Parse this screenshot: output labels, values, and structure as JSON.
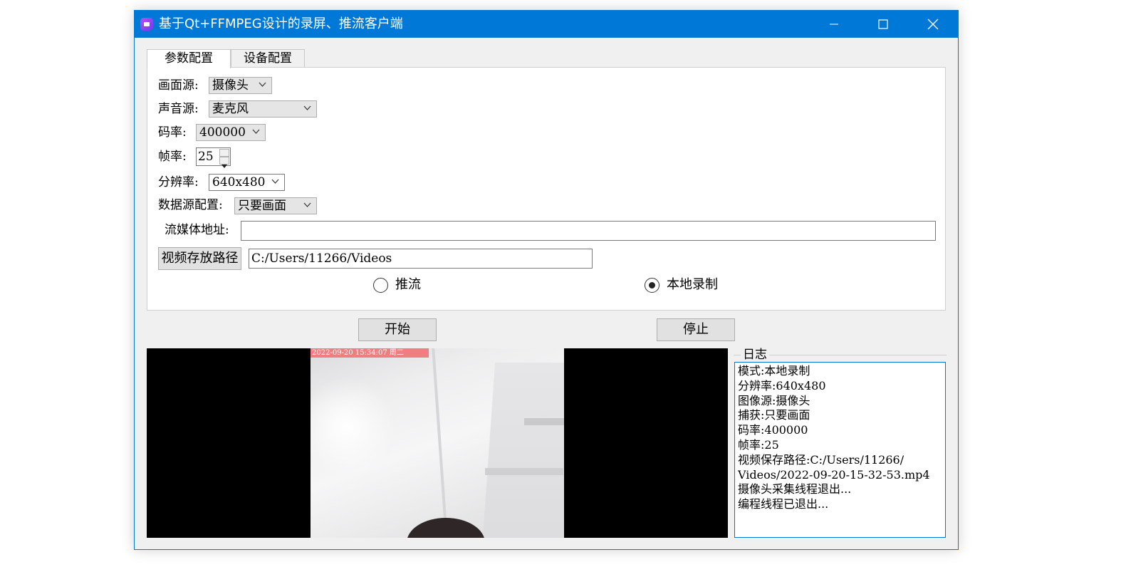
{
  "window": {
    "title": "基于Qt+FFMPEG设计的录屏、推流客户端",
    "accent_color": "#0078d7",
    "controls": [
      "minimize-icon",
      "maximize-icon",
      "close-icon"
    ]
  },
  "tabs": [
    {
      "label": "参数配置",
      "active": true
    },
    {
      "label": "设备配置",
      "active": false
    }
  ],
  "params": {
    "video_source": {
      "label": "画面源:",
      "value": "摄像头"
    },
    "audio_source": {
      "label": "声音源:",
      "value": "麦克风"
    },
    "bitrate": {
      "label": "码率:",
      "value": "400000"
    },
    "framerate": {
      "label": "帧率:",
      "value": "25"
    },
    "resolution": {
      "label": "分辨率:",
      "value": "640x480"
    },
    "data_source": {
      "label": "数据源配置:",
      "value": "只要画面"
    },
    "stream_url": {
      "label": "流媒体地址:",
      "value": ""
    },
    "save_path": {
      "button": "视频存放路径",
      "value": "C:/Users/11266/Videos"
    },
    "mode": {
      "options": [
        {
          "label": "推流",
          "selected": false
        },
        {
          "label": "本地录制",
          "selected": true
        }
      ]
    }
  },
  "actions": {
    "start": "开始",
    "stop": "停止"
  },
  "preview": {
    "timestamp": "2022-09-20 15:34:07 周二"
  },
  "log": {
    "title": "日志",
    "lines": [
      "模式:本地录制",
      "分辨率:640x480",
      "图像源:摄像头",
      "捕获:只要画面",
      "码率:400000",
      "帧率:25",
      "视频保存路径:C:/Users/11266/",
      "Videos/2022-09-20-15-32-53.mp4",
      "摄像头采集线程退出...",
      "编程线程已退出..."
    ]
  }
}
